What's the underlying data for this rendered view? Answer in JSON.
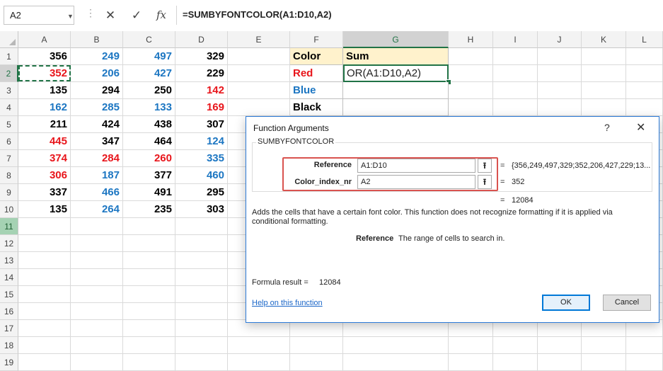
{
  "name_box": "A2",
  "formula": "=SUMBYFONTCOLOR(A1:D10,A2)",
  "formula_bar_icons": [
    "cancel-icon",
    "enter-icon",
    "fx-icon"
  ],
  "icon_glyphs": {
    "cancel": "✕",
    "enter": "✓",
    "fx": "fx",
    "ellipsis": "⋮",
    "dropdown": "▼",
    "help": "?",
    "close": "✕",
    "collapse": "⭱"
  },
  "columns": [
    "A",
    "B",
    "C",
    "D",
    "E",
    "F",
    "G",
    "H",
    "I",
    "J",
    "K",
    "L"
  ],
  "rows": [
    "1",
    "2",
    "3",
    "4",
    "5",
    "6",
    "7",
    "8",
    "9",
    "10",
    "11",
    "12",
    "13",
    "14",
    "15",
    "16",
    "17",
    "18",
    "19"
  ],
  "colors": {
    "black": "#000000",
    "red": "#e8151b",
    "blue": "#1c76c2",
    "header_yellow": "#fff2cc",
    "excel_green": "#217346"
  },
  "grid": [
    [
      {
        "v": "356",
        "c": "black"
      },
      {
        "v": "249",
        "c": "blue"
      },
      {
        "v": "497",
        "c": "blue"
      },
      {
        "v": "329",
        "c": "black"
      }
    ],
    [
      {
        "v": "352",
        "c": "red"
      },
      {
        "v": "206",
        "c": "blue"
      },
      {
        "v": "427",
        "c": "blue"
      },
      {
        "v": "229",
        "c": "black"
      }
    ],
    [
      {
        "v": "135",
        "c": "black"
      },
      {
        "v": "294",
        "c": "black"
      },
      {
        "v": "250",
        "c": "black"
      },
      {
        "v": "142",
        "c": "red"
      }
    ],
    [
      {
        "v": "162",
        "c": "blue"
      },
      {
        "v": "285",
        "c": "blue"
      },
      {
        "v": "133",
        "c": "blue"
      },
      {
        "v": "169",
        "c": "red"
      }
    ],
    [
      {
        "v": "211",
        "c": "black"
      },
      {
        "v": "424",
        "c": "black"
      },
      {
        "v": "438",
        "c": "black"
      },
      {
        "v": "307",
        "c": "black"
      }
    ],
    [
      {
        "v": "445",
        "c": "red"
      },
      {
        "v": "347",
        "c": "black"
      },
      {
        "v": "464",
        "c": "black"
      },
      {
        "v": "124",
        "c": "blue"
      }
    ],
    [
      {
        "v": "374",
        "c": "red"
      },
      {
        "v": "284",
        "c": "red"
      },
      {
        "v": "260",
        "c": "red"
      },
      {
        "v": "335",
        "c": "blue"
      }
    ],
    [
      {
        "v": "306",
        "c": "red"
      },
      {
        "v": "187",
        "c": "blue"
      },
      {
        "v": "377",
        "c": "black"
      },
      {
        "v": "460",
        "c": "blue"
      }
    ],
    [
      {
        "v": "337",
        "c": "black"
      },
      {
        "v": "466",
        "c": "blue"
      },
      {
        "v": "491",
        "c": "black"
      },
      {
        "v": "295",
        "c": "black"
      }
    ],
    [
      {
        "v": "135",
        "c": "black"
      },
      {
        "v": "264",
        "c": "blue"
      },
      {
        "v": "235",
        "c": "black"
      },
      {
        "v": "303",
        "c": "black"
      }
    ]
  ],
  "summary_table": {
    "header": {
      "color": "Color",
      "sum": "Sum"
    },
    "rows": [
      {
        "label": "Red",
        "c": "red",
        "sum": "OR(A1:D10,A2)"
      },
      {
        "label": "Blue",
        "c": "blue",
        "sum": ""
      },
      {
        "label": "Black",
        "c": "black",
        "sum": ""
      }
    ]
  },
  "dialog": {
    "title": "Function Arguments",
    "function_name": "SUMBYFONTCOLOR",
    "args": [
      {
        "label": "Reference",
        "value": "A1:D10",
        "result": "{356,249,497,329;352,206,427,229;13..."
      },
      {
        "label": "Color_index_nr",
        "value": "A2",
        "result": "352"
      }
    ],
    "total_result": "12084",
    "description": "Adds the cells that have a certain font color. This function does not recognize formatting if it is applied via conditional formatting.",
    "param_name": "Reference",
    "param_desc": "The range of cells to search in.",
    "formula_result_label": "Formula result =",
    "formula_result_value": "12084",
    "help_link": "Help on this function",
    "ok": "OK",
    "cancel": "Cancel",
    "eq": "="
  }
}
